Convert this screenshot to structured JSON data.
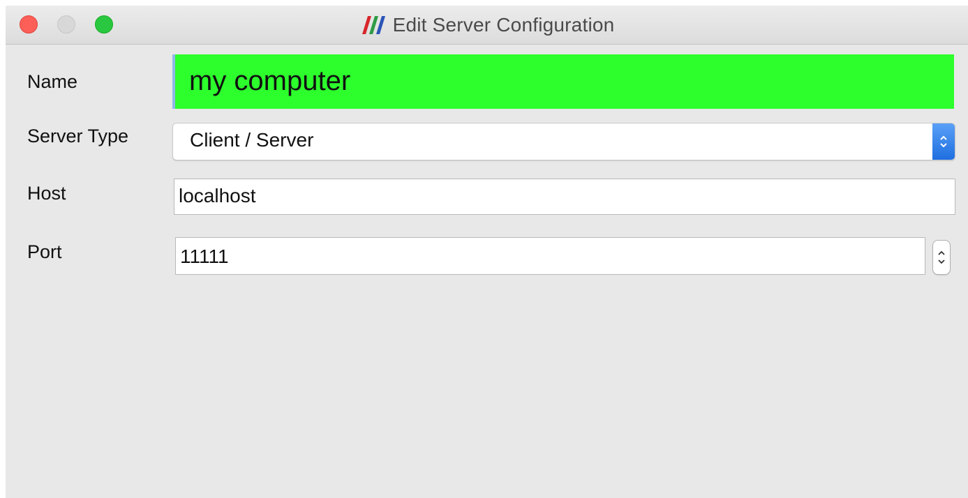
{
  "window": {
    "title": "Edit Server Configuration",
    "controls": [
      "close",
      "minimize",
      "zoom"
    ],
    "app_icon": "paraview-logo-icon"
  },
  "form": {
    "name": {
      "label": "Name",
      "value": "my computer",
      "highlight_color": "#2cff2c"
    },
    "server_type": {
      "label": "Server Type",
      "value": "Client / Server"
    },
    "host": {
      "label": "Host",
      "value": "localhost"
    },
    "port": {
      "label": "Port",
      "value": "11111"
    }
  },
  "colors": {
    "accent": "#1f6fe0",
    "window_bg": "#e8e8e8",
    "close": "#fc5f57",
    "zoom": "#2ac840"
  }
}
